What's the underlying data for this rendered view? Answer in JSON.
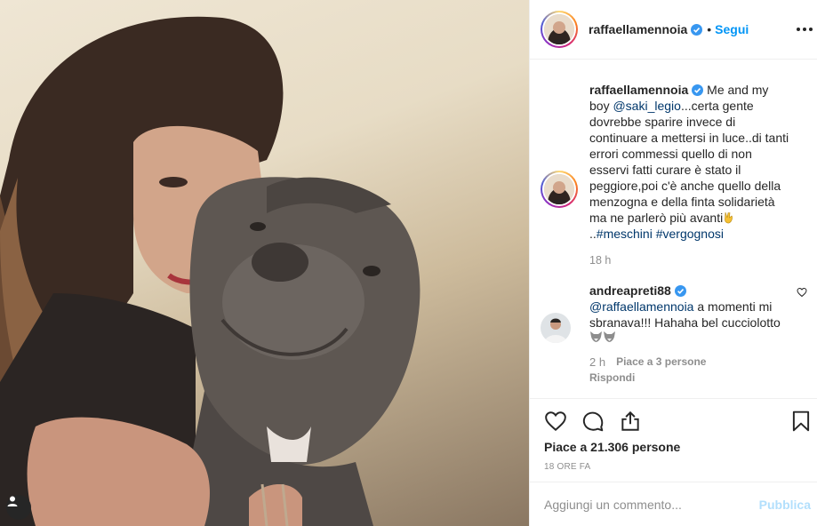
{
  "post": {
    "username": "raffaellamennoia",
    "follow_label": "Segui",
    "separator": "•"
  },
  "caption": {
    "username": "raffaellamennoia",
    "text_intro": "Me and my boy",
    "mention": "@saki_legio",
    "text_body": "...certa gente dovrebbe sparire invece di continuare a mettersi in luce..di tanti errori commessi quello di non esservi fatti curare è stato il peggiore,poi c'è anche quello della menzogna e della finta solidarietà ma ne parlerò più avanti",
    "text_after_emoji": "..",
    "hashtag1": "#meschini",
    "hashtag2": "#vergognosi",
    "time": "18 h"
  },
  "comment": {
    "username": "andreapreti88",
    "mention": "@raffaellamennoia",
    "text": " a momenti mi sbranava!!! Hahaha bel cucciolotto",
    "time": "2 h",
    "likes": "Piace a 3 persone",
    "reply_label": "Rispondi"
  },
  "actions": {
    "likes_text": "Piace a 21.306 persone",
    "posted_time": "18 ORE FA"
  },
  "add_comment": {
    "placeholder": "Aggiungi un commento...",
    "publish_label": "Pubblica"
  },
  "icons": {
    "verified": "verified-badge-icon",
    "more": "more-options-icon",
    "like": "heart-icon",
    "comment": "comment-bubble-icon",
    "share": "share-icon",
    "save": "bookmark-icon",
    "tag": "user-tag-icon"
  },
  "colors": {
    "link_blue": "#0095f6",
    "mention_dark": "#00376b",
    "muted": "#8e8e8e",
    "publish_disabled": "#b2dffc"
  }
}
